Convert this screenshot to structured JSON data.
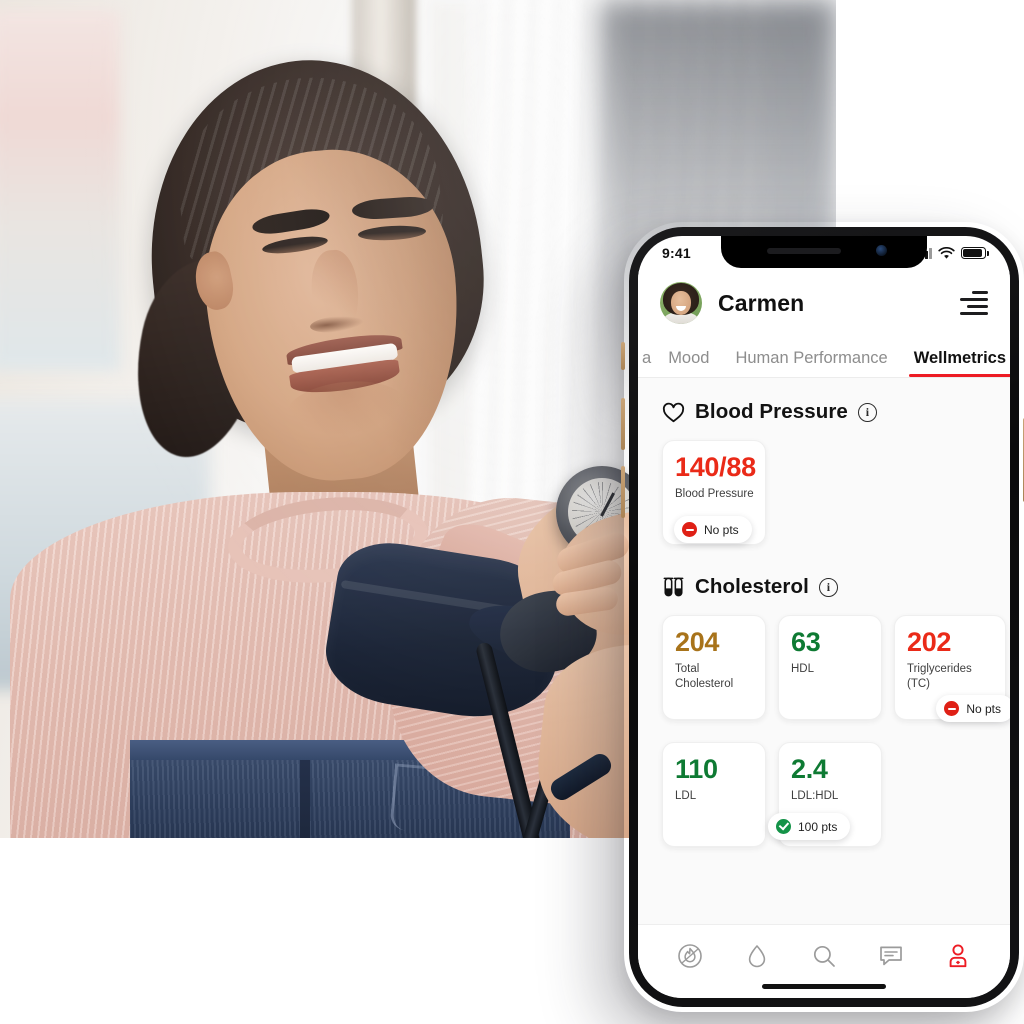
{
  "photo": {
    "alt_description": "Smiling woman in pink sweater having blood pressure measured with a cuff by a clinician"
  },
  "phone": {
    "status_bar": {
      "time": "9:41",
      "signal_icon": "cellular-bars-icon",
      "wifi_icon": "wifi-icon",
      "battery_icon": "battery-full-icon"
    },
    "header": {
      "avatar_icon": "user-avatar",
      "user_name": "Carmen",
      "menu_icon": "hamburger-menu-icon"
    },
    "tabs": [
      {
        "label": "a",
        "active": false,
        "partial": true
      },
      {
        "label": "Mood",
        "active": false,
        "partial": false
      },
      {
        "label": "Human Performance",
        "active": false,
        "partial": false
      },
      {
        "label": "Wellmetrics",
        "active": true,
        "partial": false
      }
    ],
    "sections": [
      {
        "id": "blood-pressure",
        "icon": "heart-icon",
        "title": "Blood Pressure",
        "info_icon": "info-icon",
        "info_label": "i",
        "cards": [
          {
            "value": "140/88",
            "label": "Blood Pressure",
            "color_key": "red",
            "badge": {
              "text": "No pts",
              "status": "none",
              "icon": "minus-circle-icon"
            }
          }
        ]
      },
      {
        "id": "cholesterol",
        "icon": "test-tubes-icon",
        "title": "Cholesterol",
        "info_icon": "info-icon",
        "info_label": "i",
        "cards": [
          {
            "value": "204",
            "label": "Total Cholesterol",
            "color_key": "gold",
            "badge": null
          },
          {
            "value": "63",
            "label": "HDL",
            "color_key": "green",
            "badge": null
          },
          {
            "value": "202",
            "label": "Triglycerides (TC)",
            "color_key": "red",
            "badge": {
              "text": "No pts",
              "status": "none",
              "icon": "minus-circle-icon"
            }
          },
          {
            "value": "110",
            "label": "LDL",
            "color_key": "green",
            "badge": null
          },
          {
            "value": "2.4",
            "label": "LDL:HDL",
            "color_key": "green",
            "badge": {
              "text": "100 pts",
              "status": "good",
              "icon": "check-circle-icon"
            }
          }
        ]
      }
    ],
    "bottom_nav": [
      {
        "icon": "flame-circle-icon",
        "active": false
      },
      {
        "icon": "water-drop-icon",
        "active": false
      },
      {
        "icon": "search-icon",
        "active": false
      },
      {
        "icon": "chat-bubble-icon",
        "active": false
      },
      {
        "icon": "profile-person-icon",
        "active": true
      }
    ]
  },
  "colors": {
    "accent_red": "#ED1C24",
    "value_red": "#EA2A18",
    "value_green": "#0E7A33",
    "value_gold": "#A8731A",
    "badge_red": "#DF2016",
    "badge_green": "#149348",
    "page_background": "#FFFFFF",
    "content_background": "#FAFAFA"
  }
}
